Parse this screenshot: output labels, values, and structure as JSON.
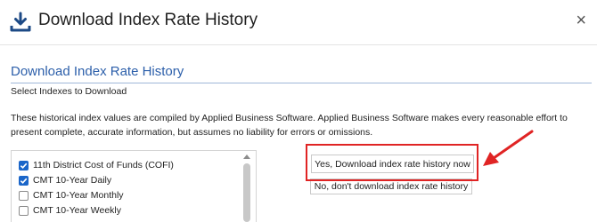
{
  "dialog": {
    "title": "Download Index Rate History",
    "title_icon": "download-icon",
    "close_label": "×",
    "close_icon": "close-icon"
  },
  "section": {
    "heading": "Download Index Rate History",
    "subheading": "Select Indexes to Download",
    "disclaimer": "These historical index values are compiled by Applied Business Software. Applied Business Software makes every reasonable effort to present complete, accurate information, but assumes no liability for errors or omissions."
  },
  "indexes": [
    {
      "label": "11th District Cost of Funds (COFI)",
      "checked": true
    },
    {
      "label": "CMT 10-Year Daily",
      "checked": true
    },
    {
      "label": "CMT 10-Year Monthly",
      "checked": false
    },
    {
      "label": "CMT 10-Year Weekly",
      "checked": false
    }
  ],
  "actions": {
    "yes_label": "Yes, Download index rate history now",
    "no_label": "No, don't download index rate history"
  },
  "colors": {
    "accent": "#2c5faa",
    "checkbox": "#1b66c9",
    "annotation": "#e02424"
  }
}
